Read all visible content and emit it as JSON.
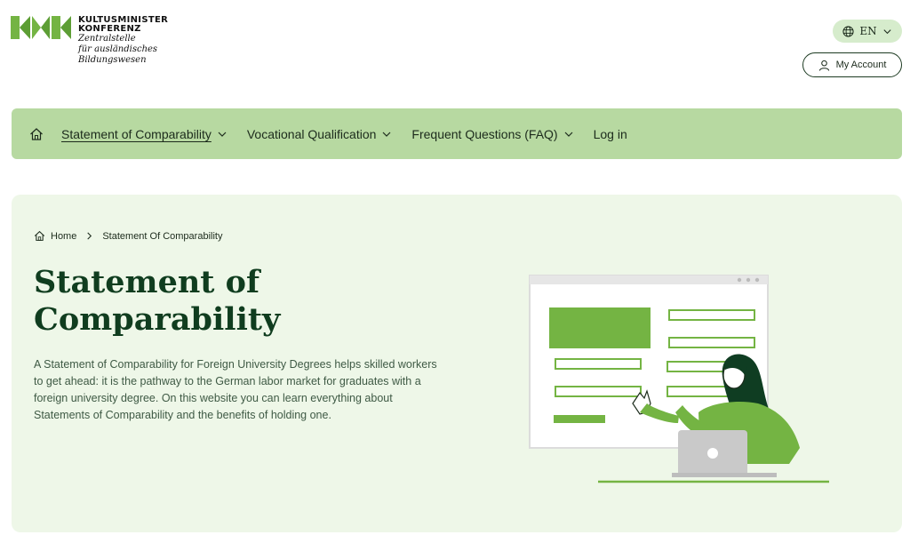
{
  "header": {
    "logo": {
      "title_line1": "KULTUSMINISTER",
      "title_line2": "KONFERENZ",
      "sub_line1": "Zentralstelle",
      "sub_line2": "für ausländisches",
      "sub_line3": "Bildungswesen"
    },
    "language": {
      "value": "EN",
      "icon": "globe-icon"
    },
    "account_label": "My Account"
  },
  "nav": {
    "items": [
      {
        "label": "Statement of Comparability",
        "has_dropdown": true,
        "active": true
      },
      {
        "label": "Vocational Qualification",
        "has_dropdown": true
      },
      {
        "label": "Frequent Questions (FAQ)",
        "has_dropdown": true
      },
      {
        "label": "Log in",
        "has_dropdown": false
      }
    ]
  },
  "hero": {
    "breadcrumb": {
      "home": "Home",
      "current": "Statement Of Comparability"
    },
    "title_line1": "Statement of",
    "title_line2": "Comparability",
    "text": "A Statement of Comparability for Foreign University Degrees helps skilled workers to get ahead: it is the pathway to the German labor market for graduates with a foreign university degree. On this website you can learn everything about Statements of Comparability and the benefits of holding one."
  },
  "colors": {
    "nav_bg": "#b7d9a1",
    "hero_bg": "#eef7e8",
    "accent_green": "#74b443",
    "title_green": "#103d1f"
  }
}
